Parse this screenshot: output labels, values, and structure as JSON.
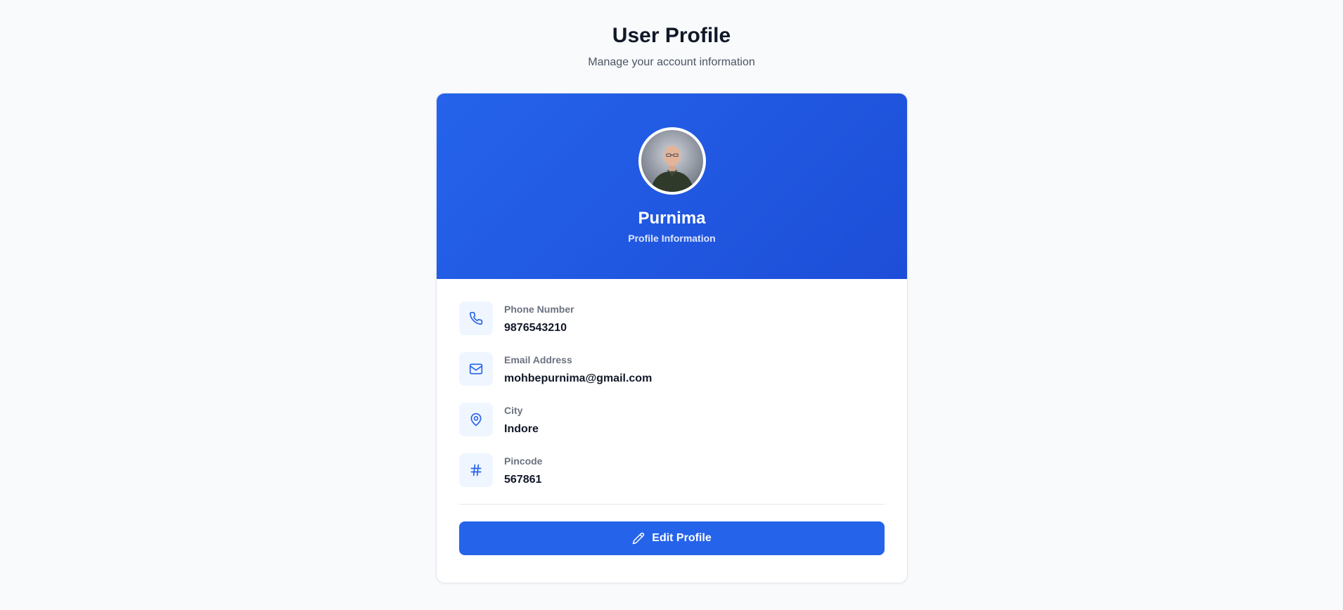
{
  "header": {
    "title": "User Profile",
    "subtitle": "Manage your account information"
  },
  "profile": {
    "name": "Purnima",
    "caption": "Profile Information",
    "avatar_icon": "user-avatar-photo"
  },
  "fields": [
    {
      "label": "Phone Number",
      "value": "9876543210",
      "icon": "phone-icon"
    },
    {
      "label": "Email Address",
      "value": "mohbepurnima@gmail.com",
      "icon": "mail-icon"
    },
    {
      "label": "City",
      "value": "Indore",
      "icon": "map-pin-icon"
    },
    {
      "label": "Pincode",
      "value": "567861",
      "icon": "hash-icon"
    }
  ],
  "actions": {
    "edit_label": "Edit Profile",
    "edit_icon": "pencil-icon"
  },
  "colors": {
    "accent": "#2563eb",
    "accent_dark": "#1d4ed8",
    "icon_bg": "#eff6ff",
    "page_bg": "#f8fafc"
  }
}
